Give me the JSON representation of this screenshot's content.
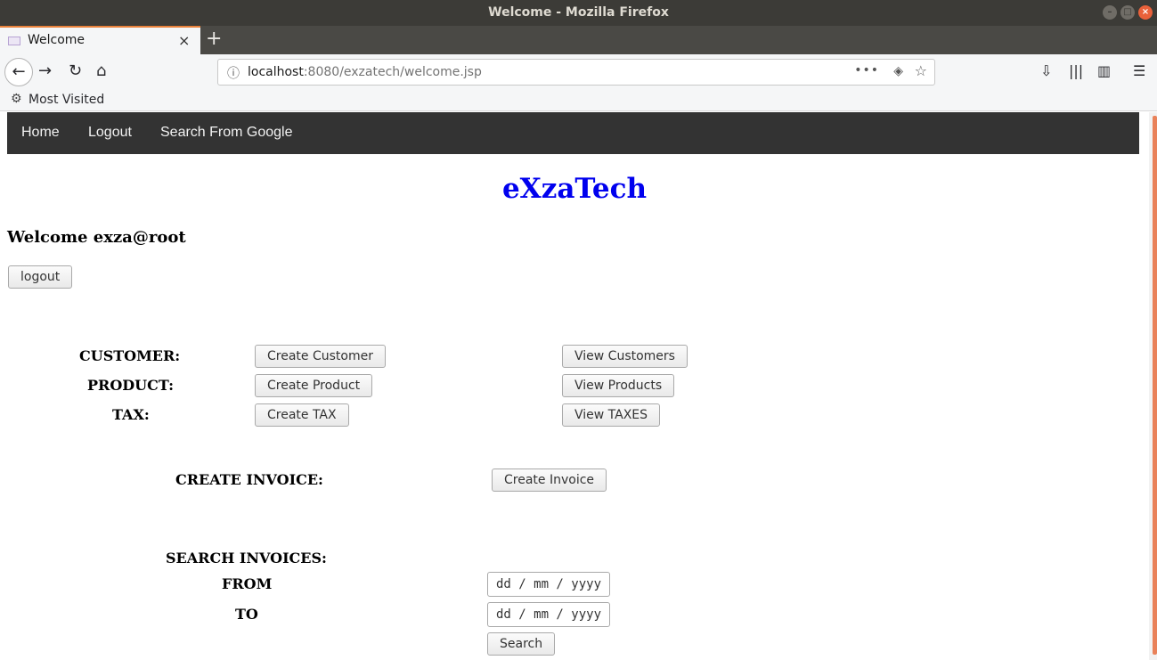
{
  "window": {
    "title": "Welcome - Mozilla Firefox"
  },
  "tab": {
    "label": "Welcome",
    "close_glyph": "×",
    "new_tab_glyph": "+"
  },
  "browser": {
    "url_host": "localhost",
    "url_rest": ":8080/exzatech/welcome.jsp",
    "bookmarks_label": "Most Visited",
    "icons": [
      "back-icon",
      "forward-icon",
      "reload-icon",
      "home-icon",
      "info-icon",
      "page-actions-icon",
      "pocket-icon",
      "bookmark-star-icon",
      "downloads-icon",
      "library-icon",
      "sidebar-icon",
      "menu-icon"
    ]
  },
  "page": {
    "nav": {
      "home": "Home",
      "logout": "Logout",
      "google": "Search From Google"
    },
    "brand": "eXzaTech",
    "welcome": "Welcome exza@root",
    "logout_button": "logout",
    "customer": {
      "label": "CUSTOMER:",
      "create": "Create Customer",
      "view": "View Customers"
    },
    "product": {
      "label": "PRODUCT:",
      "create": "Create Product",
      "view": "View Products"
    },
    "tax": {
      "label": "TAX:",
      "create": "Create TAX",
      "view": "View TAXES"
    },
    "invoice": {
      "label": "CREATE INVOICE:",
      "create": "Create Invoice"
    },
    "search": {
      "label": "SEARCH INVOICES:",
      "from_label": "FROM",
      "to_label": "TO",
      "from_placeholder": "dd / mm / yyyy",
      "to_placeholder": "dd / mm / yyyy",
      "button": "Search"
    }
  },
  "colors": {
    "accent": "#e9813a",
    "brand": "#0000ee",
    "topnav_bg": "#333333"
  }
}
